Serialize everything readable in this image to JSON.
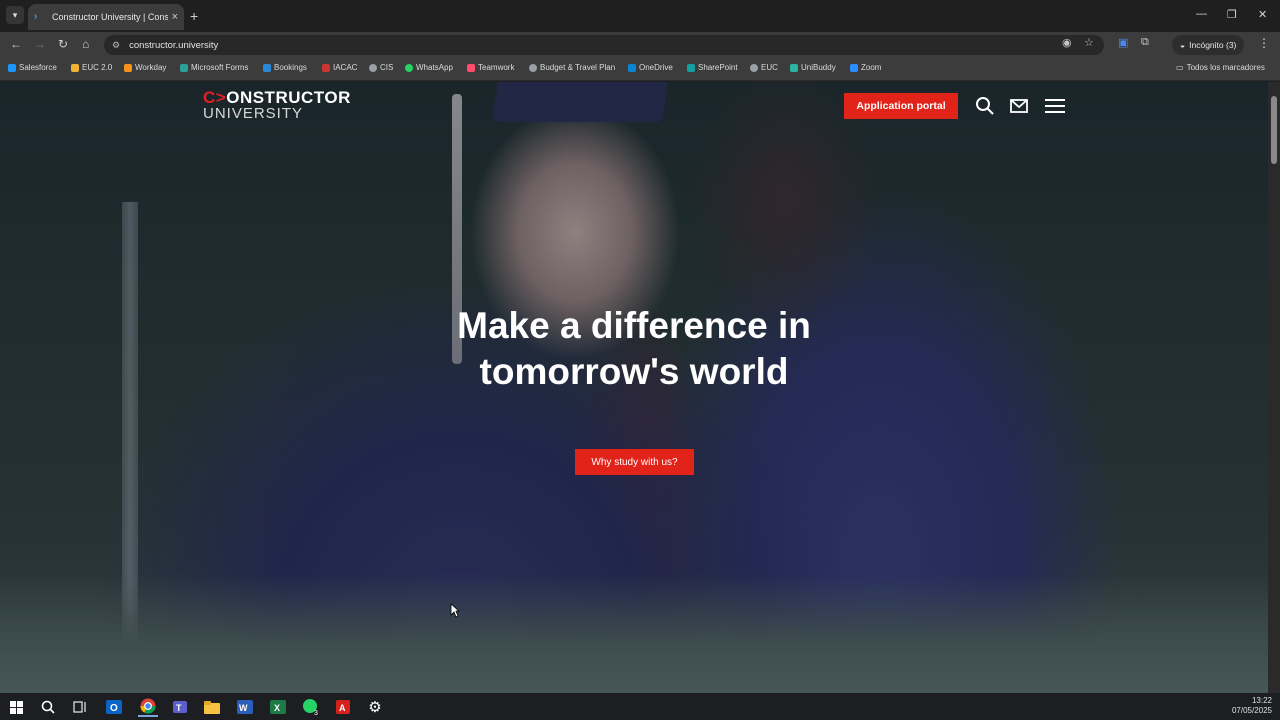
{
  "browser": {
    "tab_title": "Constructor University | Constr",
    "tab_close": "×",
    "new_tab": "+",
    "url": "constructor.university",
    "incognito_label": "Incógnito (3)",
    "window_controls": [
      "—",
      "❐",
      "✕"
    ]
  },
  "bookmarks": {
    "items": [
      {
        "label": "Salesforce",
        "color": "#1b96ff"
      },
      {
        "label": "EUC 2.0",
        "color": "#f2b233"
      },
      {
        "label": "Workday",
        "color": "#f6921e"
      },
      {
        "label": "Microsoft Forms",
        "color": "#2aa198"
      },
      {
        "label": "Bookings",
        "color": "#2b88d8"
      },
      {
        "label": "IACAC",
        "color": "#c33"
      },
      {
        "label": "CIS",
        "color": "#9aa0a6"
      },
      {
        "label": "WhatsApp",
        "color": "#25d366"
      },
      {
        "label": "Teamwork",
        "color": "#ff4b6e"
      },
      {
        "label": "Budget & Travel Plan",
        "color": "#9aa0a6"
      },
      {
        "label": "OneDrive",
        "color": "#0a84d6"
      },
      {
        "label": "SharePoint",
        "color": "#14a0a0"
      },
      {
        "label": "EUC",
        "color": "#9aa0a6"
      },
      {
        "label": "UniBuddy",
        "color": "#2bb5a0"
      },
      {
        "label": "Zoom",
        "color": "#2d8cff"
      }
    ],
    "all_bookmarks": "Todos los marcadores"
  },
  "site": {
    "logo_top_arrow": "C>",
    "logo_top_rest": "ONSTRUCTOR",
    "logo_bottom": "UNIVERSITY",
    "apply_button": "Application portal",
    "hero_line1": "Make a difference in",
    "hero_line2": "tomorrow's world",
    "cta_button": "Why study with us?",
    "accent_color": "#e2231a"
  },
  "taskbar": {
    "apps": [
      "windows-start",
      "search",
      "task-view",
      "outlook",
      "chrome",
      "teams",
      "file-explorer",
      "word",
      "excel",
      "whatsapp",
      "acrobat",
      "settings"
    ],
    "whatsapp_badge": "3",
    "time": "13:22",
    "date": "07/05/2025"
  }
}
